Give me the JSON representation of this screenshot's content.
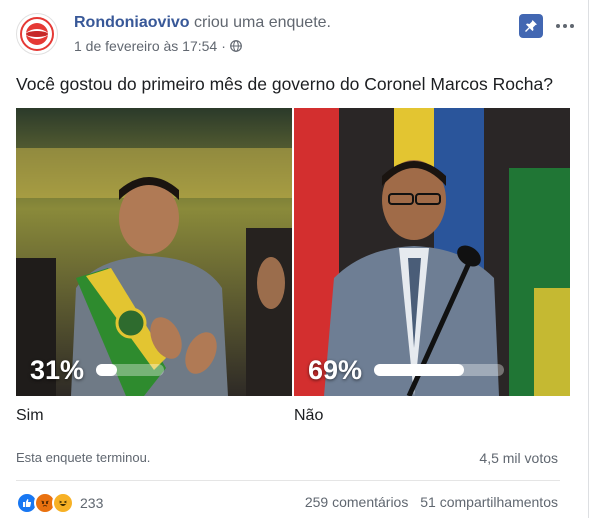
{
  "post": {
    "page_name": "Rondoniaovivo",
    "action": "criou uma enquete.",
    "timestamp": "1 de fevereiro às 17:54",
    "separator": "·",
    "privacy_icon": "globe-icon"
  },
  "poll": {
    "question": "Você gostou do primeiro mês de governo do Coronel Marcos Rocha?",
    "options": [
      {
        "label": "Sim",
        "percent_label": "31%",
        "percent": 31
      },
      {
        "label": "Não",
        "percent_label": "69%",
        "percent": 69
      }
    ],
    "status": "Esta enquete terminou.",
    "votes": "4,5 mil votos"
  },
  "engagement": {
    "reactions": [
      "like",
      "angry",
      "haha"
    ],
    "reaction_count": "233",
    "comments": "259 comentários",
    "shares": "51 compartilhamentos"
  },
  "colors": {
    "brand_blue": "#385898",
    "pin_blue": "#4267b2",
    "like_blue": "#1877f2",
    "angry_orange": "#e9710f",
    "haha_yellow": "#f7b125"
  }
}
